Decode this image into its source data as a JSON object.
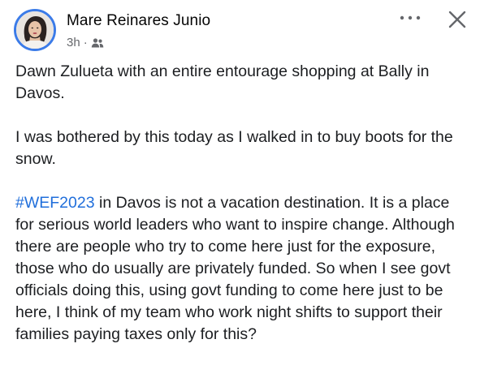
{
  "post": {
    "author": "Mare Reinares Junio",
    "time": "3h",
    "separator": "·",
    "audience_icon": "friends-icon",
    "paragraphs": [
      {
        "text": "Dawn Zulueta with an entire entourage shopping at Bally in Davos."
      },
      {
        "text": "I was bothered by this today as I walked in to buy boots for the snow."
      },
      {
        "hashtag": "#WEF2023",
        "text": " in Davos is not a vacation destination. It is a place for serious world leaders who want to inspire change. Although there are people who try to come here just for the exposure, those who do usually are privately funded. So when I see govt officials doing this, using govt funding to come here just to be here, I think of my team who work night shifts to support their families paying taxes only for this?"
      }
    ]
  },
  "icons": {
    "more": "more-options-icon",
    "close": "close-icon"
  },
  "colors": {
    "hashtag": "#216fdb",
    "avatar_ring": "#3b7be8",
    "meta_text": "#65676b"
  }
}
